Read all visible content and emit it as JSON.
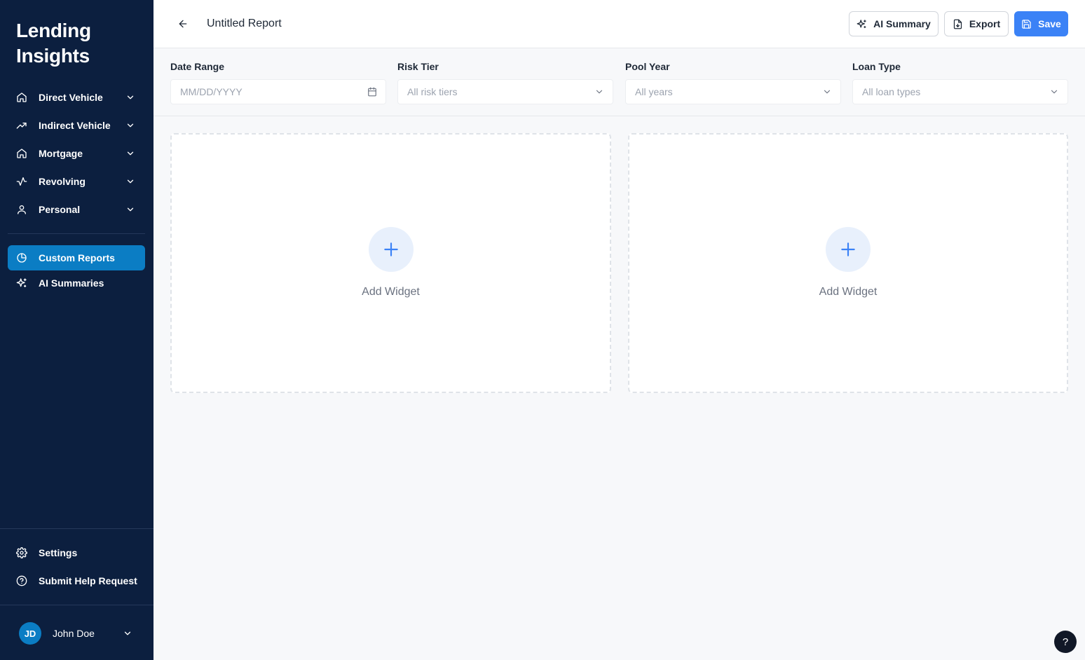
{
  "sidebar": {
    "brand": "Lending Insights",
    "items": [
      {
        "label": "Direct Vehicle"
      },
      {
        "label": "Indirect Vehicle"
      },
      {
        "label": "Mortgage"
      },
      {
        "label": "Revolving"
      },
      {
        "label": "Personal"
      }
    ],
    "reports": [
      {
        "label": "Custom Reports",
        "active": true
      },
      {
        "label": "AI Summaries"
      }
    ],
    "footer": [
      {
        "label": "Settings"
      },
      {
        "label": "Submit Help Request"
      }
    ],
    "user": {
      "initials": "JD",
      "name": "John Doe"
    }
  },
  "header": {
    "title": "Untitled Report",
    "ai_summary_label": "AI Summary",
    "export_label": "Export",
    "save_label": "Save"
  },
  "filters": [
    {
      "label": "Date Range",
      "placeholder": "MM/DD/YYYY"
    },
    {
      "label": "Risk Tier",
      "value": "All risk tiers"
    },
    {
      "label": "Pool Year",
      "value": "All years"
    },
    {
      "label": "Loan Type",
      "value": "All loan types"
    }
  ],
  "widgets": [
    {
      "label": "Add Widget"
    },
    {
      "label": "Add Widget"
    }
  ],
  "help_label": "?",
  "colors": {
    "sidebar_bg": "#0c1f3f",
    "active_item": "#0b7dc4",
    "primary": "#3b82f6"
  }
}
